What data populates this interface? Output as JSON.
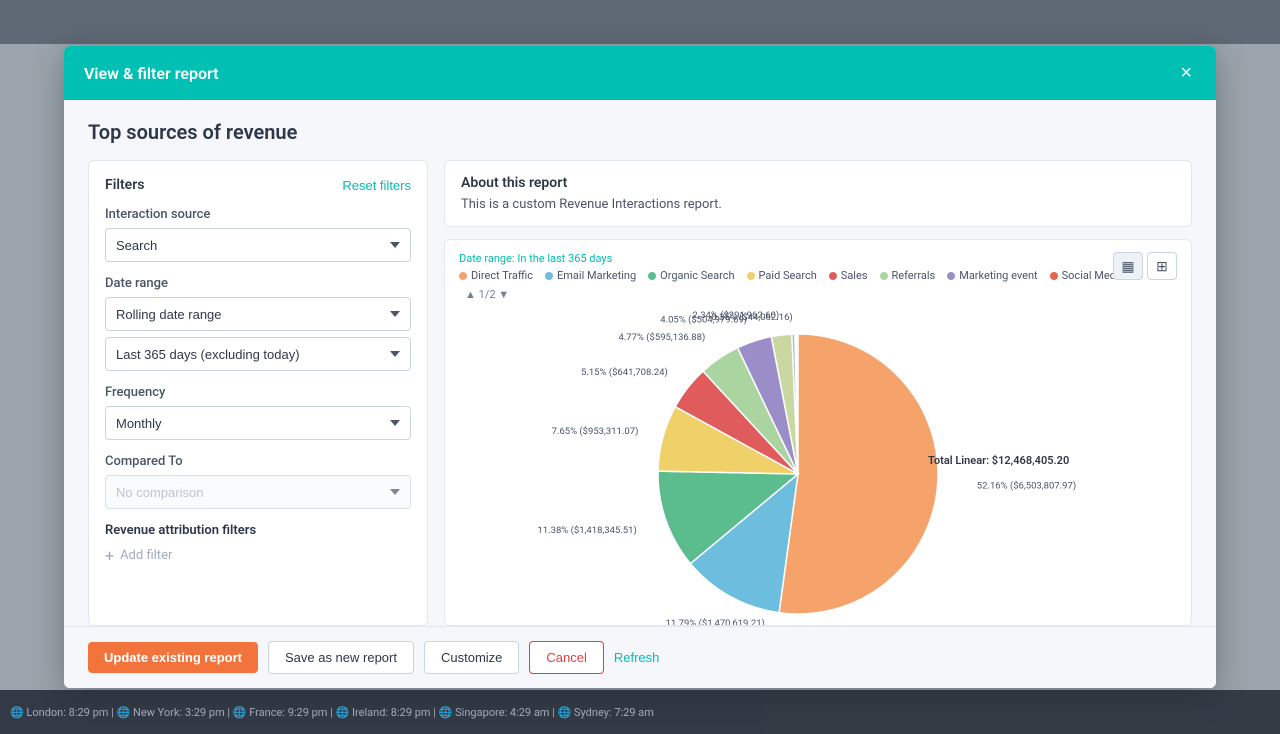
{
  "modal": {
    "header_title": "View & filter report",
    "close_icon": "×",
    "report_title": "Top sources of revenue"
  },
  "filters": {
    "section_title": "Filters",
    "reset_label": "Reset filters",
    "interaction_source_label": "Interaction source",
    "interaction_source_value": "Search",
    "date_range_label": "Date range",
    "date_range_value": "Rolling date range",
    "date_range_sub_value": "Last 365 days (excluding today)",
    "frequency_label": "Frequency",
    "frequency_value": "Monthly",
    "compared_to_label": "Compared To",
    "compared_to_value": "No comparison",
    "revenue_attribution_label": "Revenue attribution filters",
    "add_filter_label": "Add filter"
  },
  "about_report": {
    "title": "About this report",
    "description": "This is a custom Revenue Interactions report."
  },
  "chart": {
    "date_range_label": "Date range: In the last 365 days",
    "pagination": "1/2",
    "total_label": "Total Linear:",
    "total_value": "$12,468,405.20",
    "legend": [
      {
        "label": "Direct Traffic",
        "color": "#f6a26b"
      },
      {
        "label": "Email Marketing",
        "color": "#6cbdde"
      },
      {
        "label": "Organic Search",
        "color": "#5bbd8e"
      },
      {
        "label": "Paid Search",
        "color": "#f0d068"
      },
      {
        "label": "Sales",
        "color": "#e05c5c"
      },
      {
        "label": "Referrals",
        "color": "#aad4a0"
      },
      {
        "label": "Marketing event",
        "color": "#9b8dc8"
      },
      {
        "label": "Social Media",
        "color": "#e8654a"
      }
    ],
    "slices": [
      {
        "label": "52.16% ($6,503,807.97)",
        "value": 52.16,
        "color": "#f6a26b",
        "angle_start": 0,
        "angle_end": 188
      },
      {
        "label": "11.79% ($1,470,619.21)",
        "value": 11.79,
        "color": "#6cbdde",
        "angle_start": 188,
        "angle_end": 230
      },
      {
        "label": "11.38% ($1,418,345.51)",
        "value": 11.38,
        "color": "#5bbd8e",
        "angle_start": 230,
        "angle_end": 271
      },
      {
        "label": "7.65% ($953,311.07)",
        "value": 7.65,
        "color": "#f0d068",
        "angle_start": 271,
        "angle_end": 298
      },
      {
        "label": "5.15% ($641,708.24)",
        "value": 5.15,
        "color": "#e05c5c",
        "angle_start": 298,
        "angle_end": 317
      },
      {
        "label": "4.77% ($595,136.88)",
        "value": 4.77,
        "color": "#aad4a0",
        "angle_start": 317,
        "angle_end": 334
      },
      {
        "label": "4.05% ($504,979.69)",
        "value": 4.05,
        "color": "#9b8dc8",
        "angle_start": 334,
        "angle_end": 349
      },
      {
        "label": "2.34% ($291,962.60)",
        "value": 2.34,
        "color": "#c8d8a0",
        "angle_start": 349,
        "angle_end": 357
      },
      {
        "label": "0.35% ($44,062.16)",
        "value": 0.35,
        "color": "#aab8c8",
        "angle_start": 357,
        "angle_end": 360
      }
    ]
  },
  "footer": {
    "update_label": "Update existing report",
    "save_new_label": "Save as new report",
    "customize_label": "Customize",
    "cancel_label": "Cancel",
    "refresh_label": "Refresh"
  },
  "bottom_bar": {
    "text": "🌐 London: 8:29 pm  |  🌐 New York: 3:29 pm  |  🌐 France: 9:29 pm  |  🌐 Ireland: 8:29 pm  |  🌐 Singapore: 4:29 am  |  🌐 Sydney: 7:29 am"
  }
}
